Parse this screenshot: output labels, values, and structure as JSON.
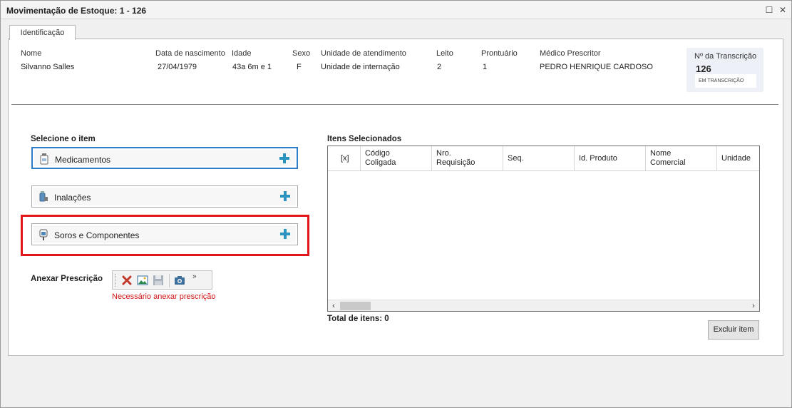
{
  "window": {
    "title": "Movimentação de Estoque: 1 - 126"
  },
  "tabs": [
    {
      "label": "Identificação",
      "active": true
    }
  ],
  "patient": {
    "fields": [
      {
        "key": "nome",
        "label": "Nome",
        "value": "Silvanno Salles"
      },
      {
        "key": "nascimento",
        "label": "Data de nascimento",
        "value": "27/04/1979"
      },
      {
        "key": "idade",
        "label": "Idade",
        "value": "43a 6m  e 1"
      },
      {
        "key": "sexo",
        "label": "Sexo",
        "value": "F"
      },
      {
        "key": "unidade",
        "label": "Unidade de atendimento",
        "value": "Unidade de internação"
      },
      {
        "key": "leito",
        "label": "Leito",
        "value": "2"
      },
      {
        "key": "prontuario",
        "label": "Prontuário",
        "value": "1"
      },
      {
        "key": "medico",
        "label": "Médico Prescritor",
        "value": "PEDRO HENRIQUE CARDOSO"
      }
    ]
  },
  "transcricao": {
    "label": "Nº da Transcrição",
    "number": "126",
    "status": "EM TRANSCRIÇÃO"
  },
  "item_select": {
    "title": "Selecione o item",
    "items": [
      {
        "label": "Medicamentos",
        "icon": "medicine-bottle-icon"
      },
      {
        "label": "Inalações",
        "icon": "inhaler-icon"
      },
      {
        "label": "Soros e Componentes",
        "icon": "iv-bag-icon"
      }
    ]
  },
  "anexar": {
    "label": "Anexar Prescrição",
    "warning": "Necessário anexar prescrição",
    "more": "»"
  },
  "selected_items": {
    "title": "Itens Selecionados",
    "columns": [
      {
        "line1": "[x]",
        "line2": ""
      },
      {
        "line1": "Código",
        "line2": "Coligada"
      },
      {
        "line1": "Nro.",
        "line2": "Requisição"
      },
      {
        "line1": "Seq.",
        "line2": ""
      },
      {
        "line1": "Id. Produto",
        "line2": ""
      },
      {
        "line1": "Nome",
        "line2": "Comercial"
      },
      {
        "line1": "Unidade",
        "line2": ""
      }
    ],
    "rows": [],
    "total_label": "Total de itens: 0",
    "delete_button": "Excluir item"
  },
  "colors": {
    "accent_blue": "#2d7cc5",
    "highlight_red": "#e0161b",
    "plus_teal": "#2a93c0",
    "warning_red": "#d21414"
  }
}
